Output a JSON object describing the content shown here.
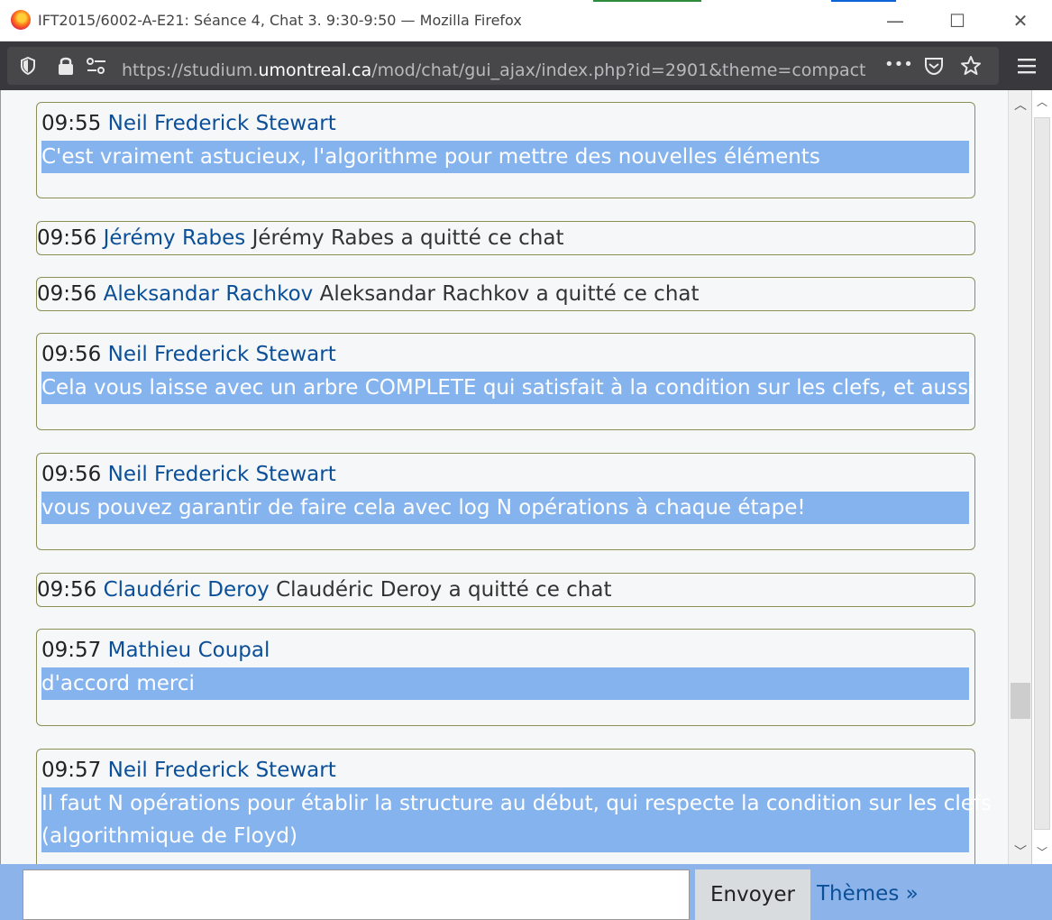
{
  "window": {
    "title": "IFT2015/6002-A-E21: Séance 4, Chat 3. 9:30-9:50 — Mozilla Firefox",
    "minimize": "—",
    "maximize": "☐",
    "close": "✕"
  },
  "navbar": {
    "url_prefix": "https://studium.",
    "url_domain": "umontreal.ca",
    "url_path": "/mod/chat/gui_ajax/index.php?id=2901&theme=compact",
    "more": "•••"
  },
  "messages": [
    {
      "type": "user",
      "time": "09:55",
      "user": "Neil Frederick Stewart",
      "lines": [
        "C'est vraiment astucieux, l'algorithme pour mettre des nouvelles éléments"
      ]
    },
    {
      "type": "system",
      "time": "09:56",
      "user": "Jérémy Rabes",
      "text": "Jérémy Rabes a quitté ce chat"
    },
    {
      "type": "system",
      "time": "09:56",
      "user": "Aleksandar Rachkov",
      "text": "Aleksandar Rachkov a quitté ce chat"
    },
    {
      "type": "user",
      "time": "09:56",
      "user": "Neil Frederick Stewart",
      "lines": [
        "Cela vous laisse avec un arbre COMPLETE qui satisfait à la condition sur les clefs, et aussi"
      ]
    },
    {
      "type": "user",
      "time": "09:56",
      "user": "Neil Frederick Stewart",
      "lines": [
        "vous pouvez garantir de faire cela avec log N opérations à chaque étape!"
      ]
    },
    {
      "type": "system",
      "time": "09:56",
      "user": "Claudéric Deroy",
      "text": "Claudéric Deroy a quitté ce chat"
    },
    {
      "type": "user",
      "time": "09:57",
      "user": "Mathieu Coupal",
      "lines": [
        "d'accord merci"
      ]
    },
    {
      "type": "user",
      "time": "09:57",
      "user": "Neil Frederick Stewart",
      "lines": [
        "Il faut N opérations pour établir la structure au début, qui respecte la condition sur les clefs",
        "(algorithmique de Floyd)"
      ]
    }
  ],
  "sendbar": {
    "input_value": "",
    "send_label": "Envoyer",
    "themes_label": "Thèmes »"
  }
}
